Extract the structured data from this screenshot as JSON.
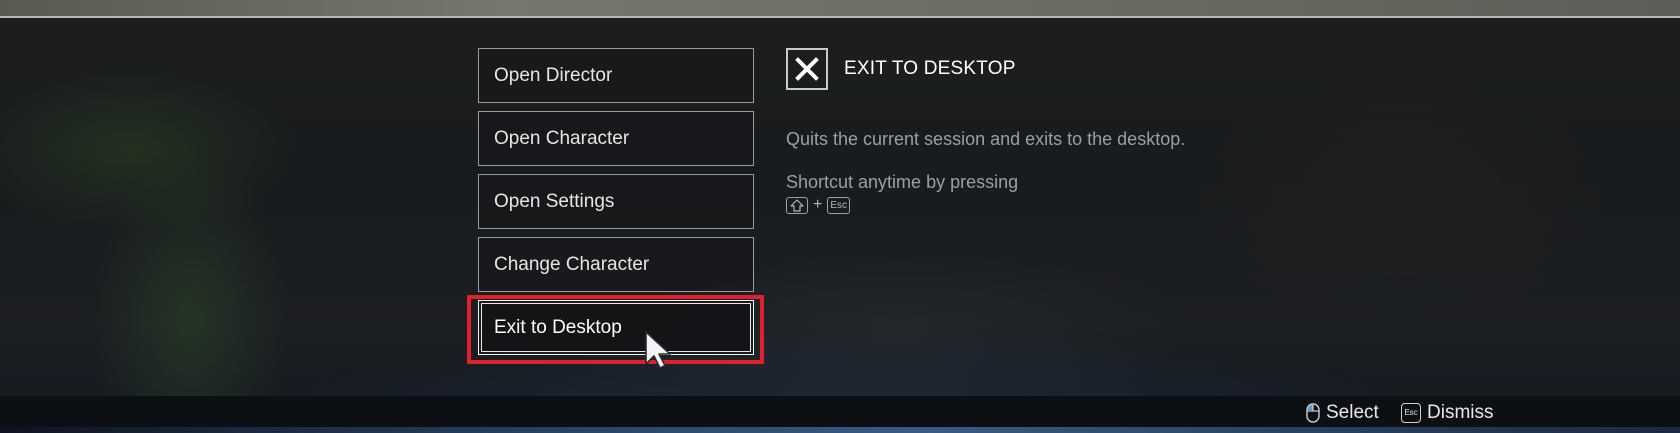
{
  "menu": {
    "items": [
      {
        "label": "Open Director"
      },
      {
        "label": "Open Character"
      },
      {
        "label": "Open Settings"
      },
      {
        "label": "Change Character"
      },
      {
        "label": "Exit to Desktop",
        "selected": true
      }
    ]
  },
  "detail": {
    "icon": "close-x-icon",
    "title": "EXIT TO DESKTOP",
    "description": "Quits the current session and exits to the desktop.",
    "shortcut_text": "Shortcut anytime by pressing",
    "shortcut_keys": {
      "shift_icon": "shift-key-icon",
      "plus": "+",
      "esc": "Esc"
    }
  },
  "footer": {
    "select_label": "Select",
    "select_icon": "mouse-left-click-icon",
    "dismiss_label": "Dismiss",
    "dismiss_key": "Esc"
  },
  "colors": {
    "highlight": "#e0202a",
    "text_primary": "#ffffff",
    "text_secondary": "#9d9e9f"
  }
}
